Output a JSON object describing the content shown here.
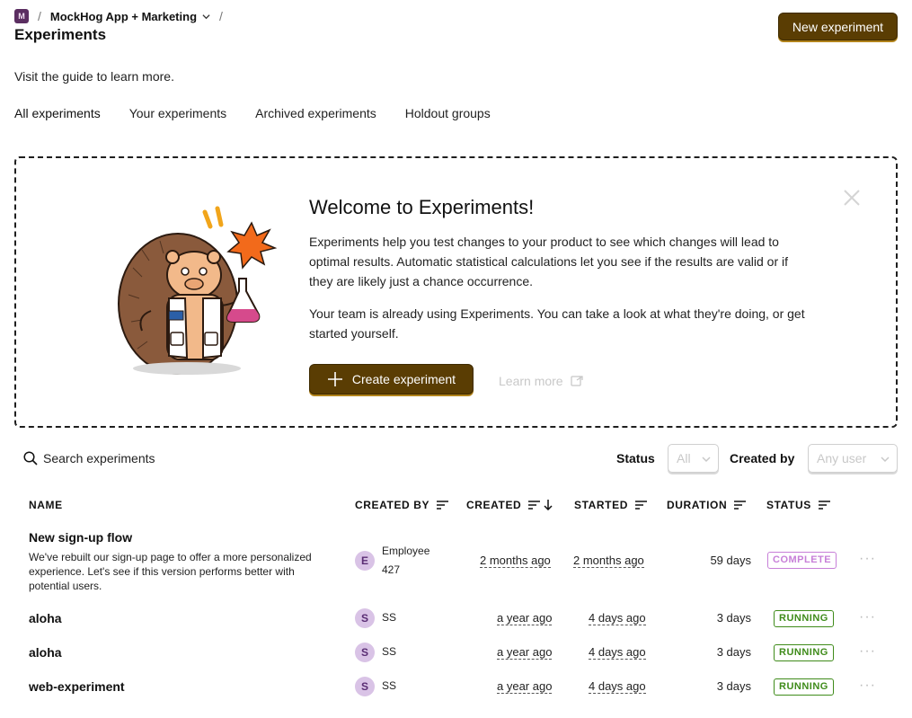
{
  "breadcrumb": {
    "project_initial": "M",
    "separator": "/",
    "project_name": "MockHog App + Marketing"
  },
  "page": {
    "title": "Experiments",
    "new_button": "New experiment",
    "guide_text": "Visit the guide to learn more."
  },
  "tabs": [
    {
      "label": "All experiments",
      "active": true
    },
    {
      "label": "Your experiments",
      "active": false
    },
    {
      "label": "Archived experiments",
      "active": false
    },
    {
      "label": "Holdout groups",
      "active": false
    }
  ],
  "welcome": {
    "title": "Welcome to Experiments!",
    "paragraph1": "Experiments help you test changes to your product to see which changes will lead to optimal results. Automatic statistical calculations let you see if the results are valid or if they are likely just a chance occurrence.",
    "paragraph2": "Your team is already using Experiments. You can take a look at what they're doing, or get started yourself.",
    "create_button": "Create experiment",
    "learn_more": "Learn more"
  },
  "filters": {
    "search_placeholder": "Search experiments",
    "status_label": "Status",
    "status_value": "All",
    "created_by_label": "Created by",
    "created_by_value": "Any user"
  },
  "table": {
    "headers": {
      "name": "NAME",
      "created_by": "CREATED BY",
      "created": "CREATED",
      "started": "STARTED",
      "duration": "DURATION",
      "status": "STATUS"
    },
    "rows": [
      {
        "name": "New sign-up flow",
        "description": "We've rebuilt our sign-up page to offer a more personalized experience. Let's see if this version performs better with potential users.",
        "avatar": "E",
        "creator": "Employee 427",
        "created": "2 months ago",
        "started": "2 months ago",
        "duration": "59 days",
        "status": "COMPLETE"
      },
      {
        "name": "aloha",
        "description": "",
        "avatar": "S",
        "creator": "SS",
        "created": "a year ago",
        "started": "4 days ago",
        "duration": "3 days",
        "status": "RUNNING"
      },
      {
        "name": "aloha",
        "description": "",
        "avatar": "S",
        "creator": "SS",
        "created": "a year ago",
        "started": "4 days ago",
        "duration": "3 days",
        "status": "RUNNING"
      },
      {
        "name": "web-experiment",
        "description": "",
        "avatar": "S",
        "creator": "SS",
        "created": "a year ago",
        "started": "4 days ago",
        "duration": "3 days",
        "status": "RUNNING"
      }
    ],
    "more_glyph": "···"
  },
  "colors": {
    "primary_button": "#5a3d03",
    "complete_badge": "#c77fd8",
    "running_badge": "#3f8b1a",
    "avatar_bg": "#d9c3e6"
  }
}
